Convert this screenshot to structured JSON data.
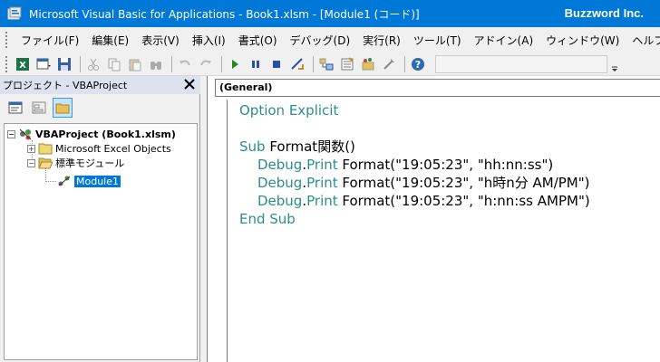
{
  "window": {
    "title": "Microsoft Visual Basic for Applications - Book1.xlsm - [Module1 (コード)]",
    "brand": "Buzzword Inc."
  },
  "menu": {
    "items": [
      "ファイル(F)",
      "編集(E)",
      "表示(V)",
      "挿入(I)",
      "書式(O)",
      "デバッグ(D)",
      "実行(R)",
      "ツール(T)",
      "アドイン(A)",
      "ウィンドウ(W)",
      "ヘルプ(H)"
    ]
  },
  "project_pane": {
    "title": "プロジェクト - VBAProject",
    "tree": {
      "root": "VBAProject (Book1.xlsm)",
      "excel_objects": "Microsoft Excel Objects",
      "modules_folder": "標準モジュール",
      "module": "Module1"
    }
  },
  "code_pane": {
    "object_combo": "(General)",
    "lines": {
      "l1_kw": "Option Explicit",
      "l3_kw": "Sub",
      "l3_rest": " Format関数()",
      "l4_kw": "Debug",
      "l4_dot": ".",
      "l4_kw2": "Print",
      "l4_rest": " Format(\"19:05:23\", \"hh:nn:ss\")",
      "l5_kw": "Debug",
      "l5_dot": ".",
      "l5_kw2": "Print",
      "l5_rest": " Format(\"19:05:23\", \"h時n分 AM/PM\")",
      "l6_kw": "Debug",
      "l6_dot": ".",
      "l6_kw2": "Print",
      "l6_rest": " Format(\"19:05:23\", \"h:nn:ss AMPM\")",
      "l7_kw": "End Sub"
    }
  },
  "colors": {
    "titlebar": "#0078d7",
    "keyword": "#2a8f8a",
    "selection": "#0078d7"
  }
}
